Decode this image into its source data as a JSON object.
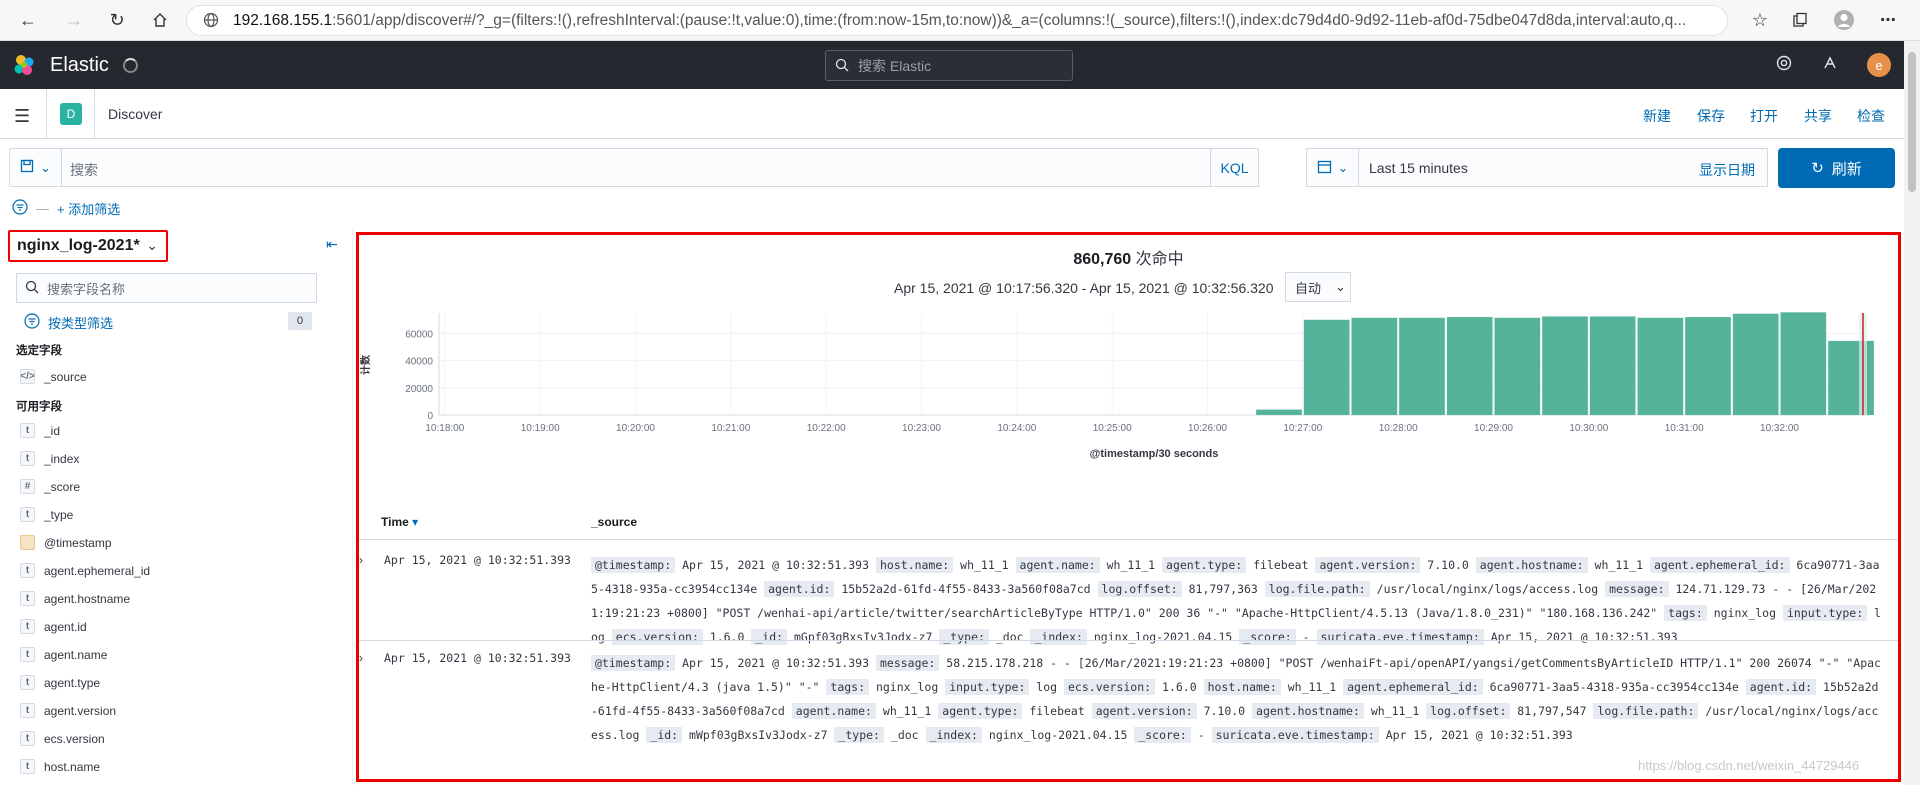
{
  "browser": {
    "url_host": "192.168.155.1",
    "url_rest": ":5601/app/discover#/?_g=(filters:!(),refreshInterval:(pause:!t,value:0),time:(from:now-15m,to:now))&_a=(columns:!(_source),filters:!(),index:dc79d4d0-9d92-11eb-af0d-75dbe047d8da,interval:auto,q..."
  },
  "header": {
    "brand": "Elastic",
    "search_placeholder": "搜索 Elastic",
    "avatar_letter": "e"
  },
  "appbar": {
    "badge": "D",
    "title": "Discover",
    "menu": [
      "新建",
      "保存",
      "打开",
      "共享",
      "检查"
    ]
  },
  "query": {
    "placeholder": "搜索",
    "language": "KQL",
    "time_range": "Last 15 minutes",
    "show_dates": "显示日期",
    "refresh": "刷新",
    "add_filter": "+ 添加筛选"
  },
  "sidebar": {
    "index_pattern": "nginx_log-2021*",
    "field_search_placeholder": "搜索字段名称",
    "type_filter": "按类型筛选",
    "type_filter_count": "0",
    "selected_title": "选定字段",
    "selected_fields": [
      {
        "type": "source",
        "name": "_source"
      }
    ],
    "available_title": "可用字段",
    "available_fields": [
      {
        "type": "t",
        "name": "_id"
      },
      {
        "type": "t",
        "name": "_index"
      },
      {
        "type": "#",
        "name": "_score"
      },
      {
        "type": "t",
        "name": "_type"
      },
      {
        "type": "date",
        "name": "@timestamp"
      },
      {
        "type": "t",
        "name": "agent.ephemeral_id"
      },
      {
        "type": "t",
        "name": "agent.hostname"
      },
      {
        "type": "t",
        "name": "agent.id"
      },
      {
        "type": "t",
        "name": "agent.name"
      },
      {
        "type": "t",
        "name": "agent.type"
      },
      {
        "type": "t",
        "name": "agent.version"
      },
      {
        "type": "t",
        "name": "ecs.version"
      },
      {
        "type": "t",
        "name": "host.name"
      }
    ]
  },
  "main": {
    "hits_count": "860,760",
    "hits_label": "次命中",
    "range": "Apr 15, 2021 @ 10:17:56.320 - Apr 15, 2021 @ 10:32:56.320",
    "interval": "自动",
    "col_time": "Time",
    "col_source": "_source"
  },
  "chart_data": {
    "type": "bar",
    "xlabel": "@timestamp/30 seconds",
    "ylabel": "计数",
    "yticks": [
      0,
      20000,
      40000,
      60000
    ],
    "ylim": [
      0,
      75000
    ],
    "xticks": [
      "10:18:00",
      "10:19:00",
      "10:20:00",
      "10:21:00",
      "10:22:00",
      "10:23:00",
      "10:24:00",
      "10:25:00",
      "10:26:00",
      "10:27:00",
      "10:28:00",
      "10:29:00",
      "10:30:00",
      "10:31:00",
      "10:32:00"
    ],
    "categories": [
      "10:26:30",
      "10:27:00",
      "10:27:30",
      "10:28:00",
      "10:28:30",
      "10:29:00",
      "10:29:30",
      "10:30:00",
      "10:30:30",
      "10:31:00",
      "10:31:30",
      "10:32:00",
      "10:32:30"
    ],
    "values": [
      4000,
      70000,
      71500,
      71500,
      72000,
      71500,
      72500,
      72500,
      71500,
      72000,
      74500,
      75500,
      54500
    ],
    "color": "#54b399",
    "marker_color": "#bd271e"
  },
  "rows": [
    {
      "time": "Apr 15, 2021 @ 10:32:51.393",
      "pairs": [
        [
          "@timestamp:",
          "Apr 15, 2021 @ 10:32:51.393"
        ],
        [
          "host.name:",
          "wh_11_1"
        ],
        [
          "agent.name:",
          "wh_11_1"
        ],
        [
          "agent.type:",
          "filebeat"
        ],
        [
          "agent.version:",
          "7.10.0"
        ],
        [
          "agent.hostname:",
          "wh_11_1"
        ],
        [
          "agent.ephemeral_id:",
          "6ca90771-3aa5-4318-935a-cc3954cc134e"
        ],
        [
          "agent.id:",
          "15b52a2d-61fd-4f55-8433-3a560f08a7cd"
        ],
        [
          "log.offset:",
          "81,797,363"
        ],
        [
          "log.file.path:",
          "/usr/local/nginx/logs/access.log"
        ],
        [
          "message:",
          "124.71.129.73 - - [26/Mar/2021:19:21:23 +0800] \"POST /wenhai-api/article/twitter/searchArticleByType HTTP/1.0\" 200 36 \"-\" \"Apache-HttpClient/4.5.13 (Java/1.8.0_231)\" \"180.168.136.242\""
        ],
        [
          "tags:",
          "nginx_log"
        ],
        [
          "input.type:",
          "log"
        ],
        [
          "ecs.version:",
          "1.6.0"
        ],
        [
          "_id:",
          "mGpf03gBxsIv3Jodx-z7"
        ],
        [
          "_type:",
          "_doc"
        ],
        [
          "_index:",
          "nginx_log-2021.04.15"
        ],
        [
          "_score:",
          " - "
        ],
        [
          "suricata.eve.timestamp:",
          "Apr 15, 2021 @ 10:32:51.393"
        ]
      ]
    },
    {
      "time": "Apr 15, 2021 @ 10:32:51.393",
      "pairs": [
        [
          "@timestamp:",
          "Apr 15, 2021 @ 10:32:51.393"
        ],
        [
          "message:",
          "58.215.178.218 - - [26/Mar/2021:19:21:23 +0800] \"POST /wenhaiFt-api/openAPI/yangsi/getCommentsByArticleID HTTP/1.1\" 200 26074 \"-\" \"Apache-HttpClient/4.3 (java 1.5)\" \"-\""
        ],
        [
          "tags:",
          "nginx_log"
        ],
        [
          "input.type:",
          "log"
        ],
        [
          "ecs.version:",
          "1.6.0"
        ],
        [
          "host.name:",
          "wh_11_1"
        ],
        [
          "agent.ephemeral_id:",
          "6ca90771-3aa5-4318-935a-cc3954cc134e"
        ],
        [
          "agent.id:",
          "15b52a2d-61fd-4f55-8433-3a560f08a7cd"
        ],
        [
          "agent.name:",
          "wh_11_1"
        ],
        [
          "agent.type:",
          "filebeat"
        ],
        [
          "agent.version:",
          "7.10.0"
        ],
        [
          "agent.hostname:",
          "wh_11_1"
        ],
        [
          "log.offset:",
          "81,797,547"
        ],
        [
          "log.file.path:",
          "/usr/local/nginx/logs/access.log"
        ],
        [
          "_id:",
          "mWpf03gBxsIv3Jodx-z7"
        ],
        [
          "_type:",
          "_doc"
        ],
        [
          "_index:",
          "nginx_log-2021.04.15"
        ],
        [
          "_score:",
          " - "
        ],
        [
          "suricata.eve.timestamp:",
          "Apr 15, 2021 @ 10:32:51.393"
        ]
      ]
    }
  ],
  "watermark": "https://blog.csdn.net/weixin_44729446"
}
